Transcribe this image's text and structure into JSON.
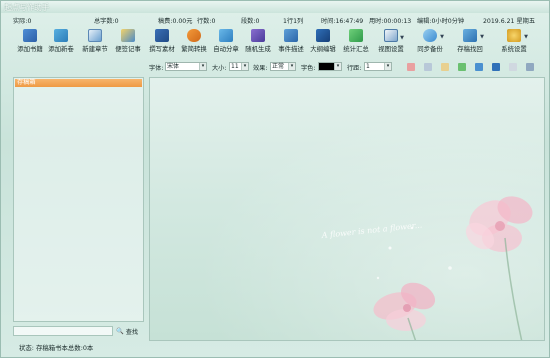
{
  "window": {
    "title": "起点写作助手"
  },
  "status": {
    "actual": "实际:0",
    "total_words": "总字数:0",
    "fee": "稿费:0.00元",
    "lines": "行数:0",
    "paragraphs": "段数:0",
    "cursor": "1行1列",
    "time": "时间:16:47:49",
    "elapsed": "用时:00:00:13",
    "edit": "编辑:0小时0分钟",
    "date": "2019.6.21  星期五"
  },
  "toolbar": {
    "buttons": [
      {
        "label": "添加书籍",
        "icon": "add-book-icon"
      },
      {
        "label": "添加新卷",
        "icon": "add-volume-icon"
      },
      {
        "label": "新建章节",
        "icon": "new-chapter-icon"
      },
      {
        "label": "便签记事",
        "icon": "note-icon"
      },
      {
        "label": "撰写素材",
        "icon": "material-icon"
      },
      {
        "label": "繁简转换",
        "icon": "convert-icon"
      },
      {
        "label": "自动分章",
        "icon": "auto-split-icon"
      },
      {
        "label": "随机生成",
        "icon": "random-icon"
      },
      {
        "label": "事件描述",
        "icon": "event-icon"
      },
      {
        "label": "大纲编辑",
        "icon": "outline-icon"
      },
      {
        "label": "统计汇总",
        "icon": "stats-icon"
      },
      {
        "label": "视图设置",
        "icon": "view-settings-icon"
      },
      {
        "label": "同步备份",
        "icon": "sync-backup-icon"
      },
      {
        "label": "存稿找回",
        "icon": "recover-icon"
      },
      {
        "label": "系统设置",
        "icon": "system-settings-icon"
      }
    ]
  },
  "format": {
    "font_label": "字体:",
    "font_value": "宋体",
    "size_label": "大小:",
    "size_value": "11",
    "effect_label": "效果:",
    "effect_value": "正常",
    "color_label": "字色:",
    "linespacing_label": "行距:",
    "linespacing_value": "1"
  },
  "tree": {
    "root": "存稿箱"
  },
  "search": {
    "button": "查找",
    "placeholder": ""
  },
  "footer": {
    "status": "状态: 存稿箱书本总数:0本"
  },
  "editor": {
    "watermark": "A flower is not a flower..."
  },
  "colors": {
    "accent": "#ef9a44",
    "frame": "#a9c6bc"
  }
}
